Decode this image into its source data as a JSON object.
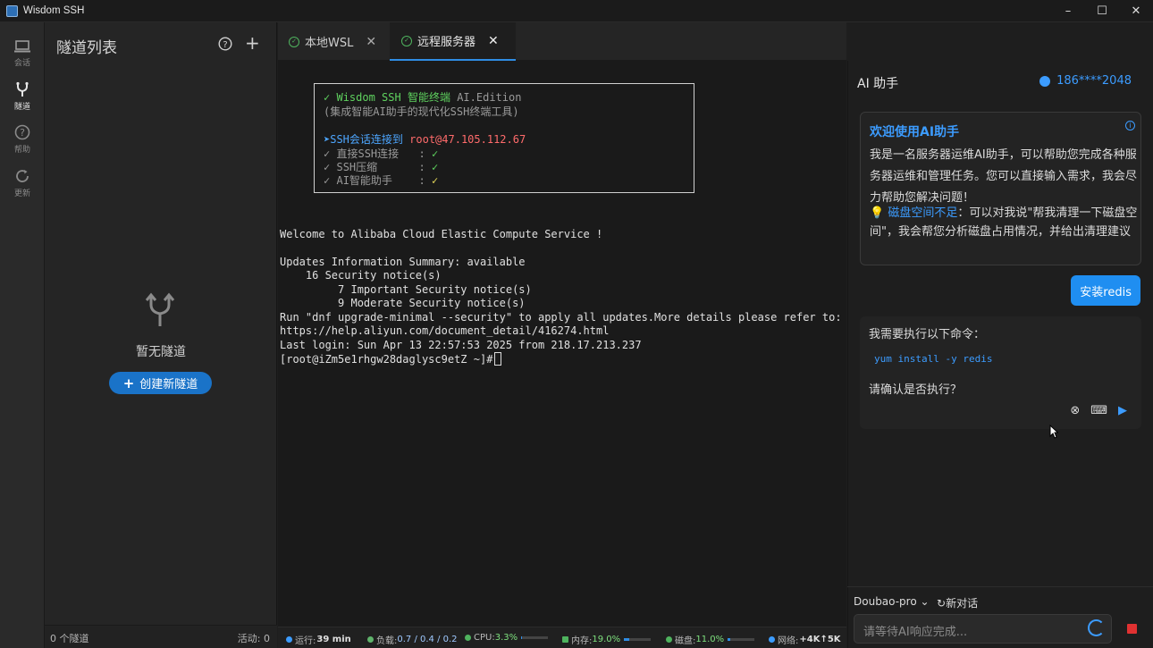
{
  "window": {
    "title": "Wisdom SSH",
    "controls": [
      "–",
      "☐",
      "✕"
    ]
  },
  "activity": [
    {
      "label": "会话",
      "icon": "laptop-icon"
    },
    {
      "label": "隧道",
      "icon": "fork-icon"
    },
    {
      "label": "帮助",
      "icon": "help-icon"
    },
    {
      "label": "更新",
      "icon": "refresh-icon"
    }
  ],
  "sidebar": {
    "title": "隧道列表",
    "add_label": "+",
    "empty_text": "暂无隧道",
    "create_label": "创建新隧道",
    "footer_count": "0 个隧道",
    "footer_active": "活动: 0"
  },
  "tabs": [
    {
      "label": "本地WSL",
      "close": "✕"
    },
    {
      "label": "远程服务器",
      "close": "✕"
    }
  ],
  "banner": {
    "title_check": "✓",
    "title_app": "Wisdom SSH",
    "title_cn": "智能终端",
    "title_ed": "AI.Edition",
    "subtitle": "(集成智能AI助手的现代化SSH终端工具)",
    "conn_arrow": "➤",
    "conn_label": "SSH会话连接到",
    "conn_target": "root@47.105.112.67",
    "features": [
      {
        "check": "✓",
        "label": "直接SSH连接",
        "sep": ":",
        "mark": "✓"
      },
      {
        "check": "✓",
        "label": "SSH压缩",
        "sep": ":",
        "mark": "✓"
      },
      {
        "check": "✓",
        "label": "AI智能助手",
        "sep": ":",
        "mark": "✓"
      }
    ]
  },
  "terminal_lines": [
    "Welcome to Alibaba Cloud Elastic Compute Service !",
    "",
    "Updates Information Summary: available",
    "    16 Security notice(s)",
    "         7 Important Security notice(s)",
    "         9 Moderate Security notice(s)",
    "Run \"dnf upgrade-minimal --security\" to apply all updates.More details please refer to:",
    "https://help.aliyun.com/document_detail/416274.html",
    "Last login: Sun Apr 13 22:57:53 2025 from 218.17.213.237",
    "[root@iZm5e1rhgw28daglysc9etZ ~]#"
  ],
  "status": {
    "uptime_label": "运行:",
    "uptime": "39 min",
    "load_label": "负载:",
    "load": "0.7 / 0.4 / 0.2",
    "cpu_label": "CPU:",
    "cpu": "3.3%",
    "cpu_frac": 0.033,
    "mem_label": "内存:",
    "mem": "19.0%",
    "mem_frac": 0.19,
    "disk_label": "磁盘:",
    "disk": "11.0%",
    "disk_frac": 0.11,
    "net_label": "网络:",
    "net": "+4K↑5K"
  },
  "ai": {
    "title": "AI 助手",
    "user": "186****2048",
    "welcome_title": "欢迎使用AI助手",
    "welcome_info": "i",
    "welcome_body": "我是一名服务器运维AI助手，可以帮助您完成各种服务器运维和管理任务。您可以直接输入需求，我会尽力帮助您解决问题！",
    "tip_icon": "💡",
    "tip_highlight": "磁盘空间不足",
    "tip_text": "：可以对我说\"帮我清理一下磁盘空间\"，我会帮您分析磁盘占用情况，并给出清理建议",
    "user_msg": "安装redis",
    "confirm_intro": "我需要执行以下命令：",
    "confirm_cmd": "yum install -y redis",
    "confirm_question": "请确认是否执行？",
    "confirm_actions": [
      "⊗",
      "⌨",
      "▶"
    ],
    "model": "Doubao-pro",
    "model_caret": "⌄",
    "new_chat_icon": "↻",
    "new_chat": "新对话",
    "input_placeholder": "请等待AI响应完成..."
  },
  "colors": {
    "accent": "#2f8de4",
    "link": "#3c9cff",
    "ok": "#4fb35e",
    "stop": "#e03131"
  }
}
